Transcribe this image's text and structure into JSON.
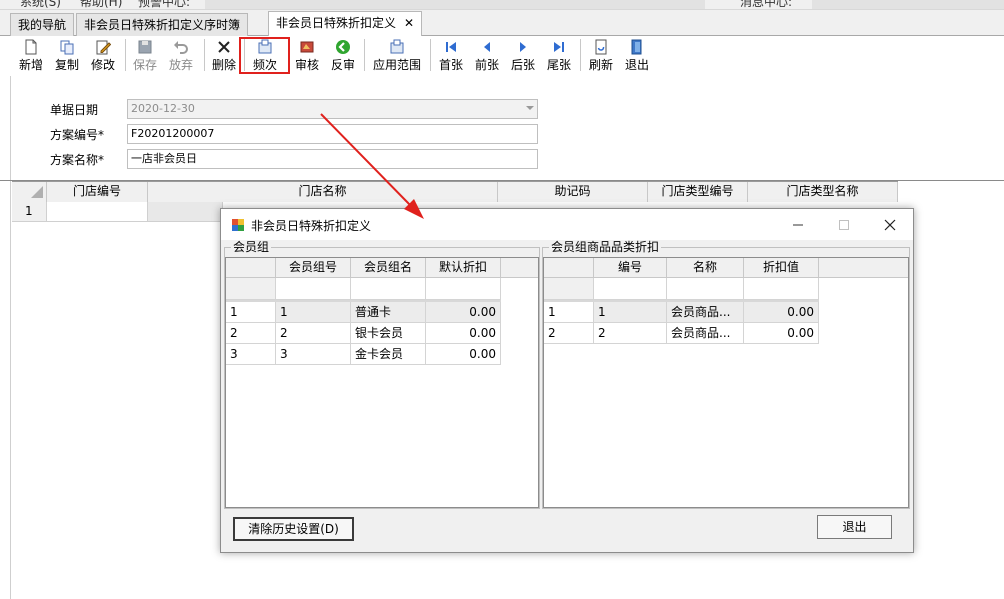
{
  "menu": {
    "cut1": "系统(S)",
    "cut2": "帮助(H)",
    "cut3": "预警中心:",
    "cut4": "消息中心:"
  },
  "tabs": [
    {
      "label": "我的导航"
    },
    {
      "label": "非会员日特殊折扣定义序时簿"
    },
    {
      "label": "非会员日特殊折扣定义",
      "close": "✕"
    }
  ],
  "toolbar": {
    "new": "新增",
    "copy": "复制",
    "edit": "修改",
    "save": "保存",
    "discard": "放弃",
    "delete": "删除",
    "frequency": "频次",
    "approve": "审核",
    "unapprove": "反审",
    "scope": "应用范围",
    "first": "首张",
    "prev": "前张",
    "next": "后张",
    "last": "尾张",
    "refresh": "刷新",
    "exit": "退出"
  },
  "form": {
    "date_label": "单据日期",
    "date_value": "2020-12-30",
    "code_label": "方案编号*",
    "code_value": "F20201200007",
    "name_label": "方案名称*",
    "name_value": "一店非会员日"
  },
  "main_grid": {
    "columns": [
      "门店编号",
      "门店名称",
      "助记码",
      "门店类型编号",
      "门店类型名称"
    ],
    "rows": [
      {
        "index": "1"
      }
    ]
  },
  "dialog": {
    "title": "非会员日特殊折扣定义",
    "member_group": {
      "title": "会员组",
      "columns": [
        "会员组号",
        "会员组名",
        "默认折扣"
      ],
      "rows": [
        {
          "index": "1",
          "id": "1",
          "name": "普通卡",
          "discount": "0.00"
        },
        {
          "index": "2",
          "id": "2",
          "name": "银卡会员",
          "discount": "0.00"
        },
        {
          "index": "3",
          "id": "3",
          "name": "金卡会员",
          "discount": "0.00"
        }
      ]
    },
    "category_discount": {
      "title": "会员组商品品类折扣",
      "columns": [
        "编号",
        "名称",
        "折扣值"
      ],
      "rows": [
        {
          "index": "1",
          "id": "1",
          "name": "会员商品...",
          "discount": "0.00"
        },
        {
          "index": "2",
          "id": "2",
          "name": "会员商品...",
          "discount": "0.00"
        }
      ]
    },
    "clear_button": "清除历史设置(D)",
    "exit_button": "退出"
  },
  "colors": {
    "highlight": "#e0211d",
    "arrow": "#e0211d"
  }
}
